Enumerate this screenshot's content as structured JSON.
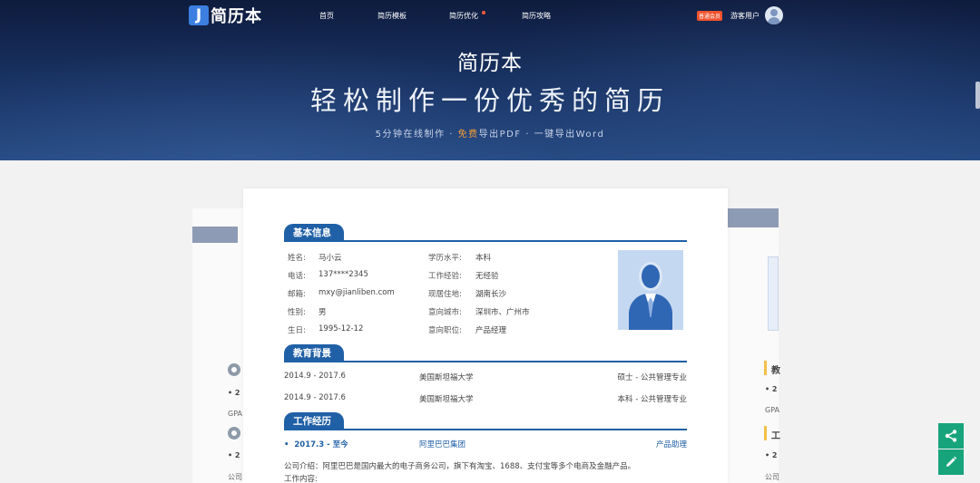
{
  "nav": {
    "logo_letter": "J",
    "logo_text": "简历本",
    "items": [
      "首页",
      "简历模板",
      "简历优化",
      "简历攻略"
    ],
    "vip_badge": "普通会员",
    "user_name": "游客用户"
  },
  "hero": {
    "title": "简历本",
    "slogan": "轻松制作一份优秀的简历",
    "sub_part1": "5分钟在线制作 · ",
    "sub_highlight": "免费",
    "sub_part2": "导出PDF · 一键导出Word",
    "highlight_color": "#f39c38"
  },
  "resume": {
    "sections": {
      "basic": "基本信息",
      "education": "教育背景",
      "work": "工作经历"
    },
    "basic_left": [
      {
        "label": "姓名:",
        "value": "马小云"
      },
      {
        "label": "电话:",
        "value": "137****2345"
      },
      {
        "label": "邮箱:",
        "value": "mxy@jianliben.com"
      },
      {
        "label": "性别:",
        "value": "男"
      },
      {
        "label": "生日:",
        "value": "1995-12-12"
      }
    ],
    "basic_right": [
      {
        "label": "学历水平:",
        "value": "本科"
      },
      {
        "label": "工作经验:",
        "value": "无经验"
      },
      {
        "label": "现居住地:",
        "value": "湖南长沙"
      },
      {
        "label": "意向城市:",
        "value": "深圳市、广州市"
      },
      {
        "label": "意向职位:",
        "value": "产品经理"
      }
    ],
    "education": [
      {
        "period": "2014.9 - 2017.6",
        "school": "美国斯坦福大学",
        "degree": "硕士 - 公共管理专业"
      },
      {
        "period": "2014.9 - 2017.6",
        "school": "美国斯坦福大学",
        "degree": "本科 - 公共管理专业"
      }
    ],
    "work": {
      "period": "2017.3 - 至今",
      "company": "阿里巴巴集团",
      "position": "产品助理",
      "intro": "公司介绍：阿里巴巴是国内最大的电子商务公司，旗下有淘宝、1688、支付宝等多个电商及金融产品。",
      "content_label": "工作内容:"
    },
    "accent_color": "#2060a6"
  },
  "background_cards": {
    "left_fragments": [
      "2",
      "GPA",
      "2",
      "公司"
    ],
    "right_fragments": [
      "教",
      "2",
      "GPA",
      "工",
      "2",
      "公司"
    ]
  },
  "fab": {
    "share_icon": "share-icon",
    "edit_icon": "pencil-icon",
    "color": "#17a47b"
  }
}
